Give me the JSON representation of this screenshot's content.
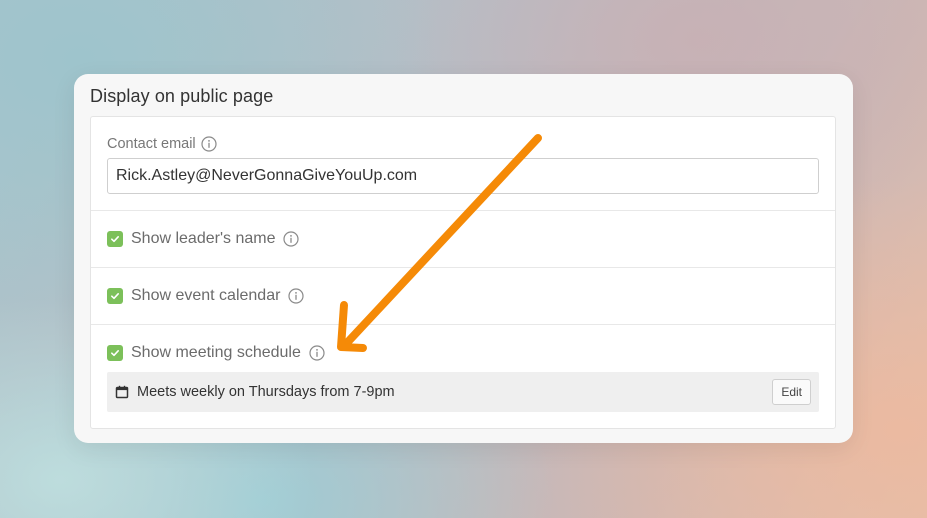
{
  "card": {
    "title": "Display on public page"
  },
  "contact": {
    "label": "Contact email",
    "value": "Rick.Astley@NeverGonnaGiveYouUp.com"
  },
  "options": [
    {
      "label": "Show leader's name",
      "checked": true
    },
    {
      "label": "Show event calendar",
      "checked": true
    },
    {
      "label": "Show meeting schedule",
      "checked": true
    }
  ],
  "schedule": {
    "text": "Meets weekly on Thursdays from 7-9pm",
    "edit_label": "Edit",
    "icon": "calendar-icon"
  },
  "colors": {
    "checkbox": "#7cc05a",
    "arrow": "#f58a07"
  }
}
